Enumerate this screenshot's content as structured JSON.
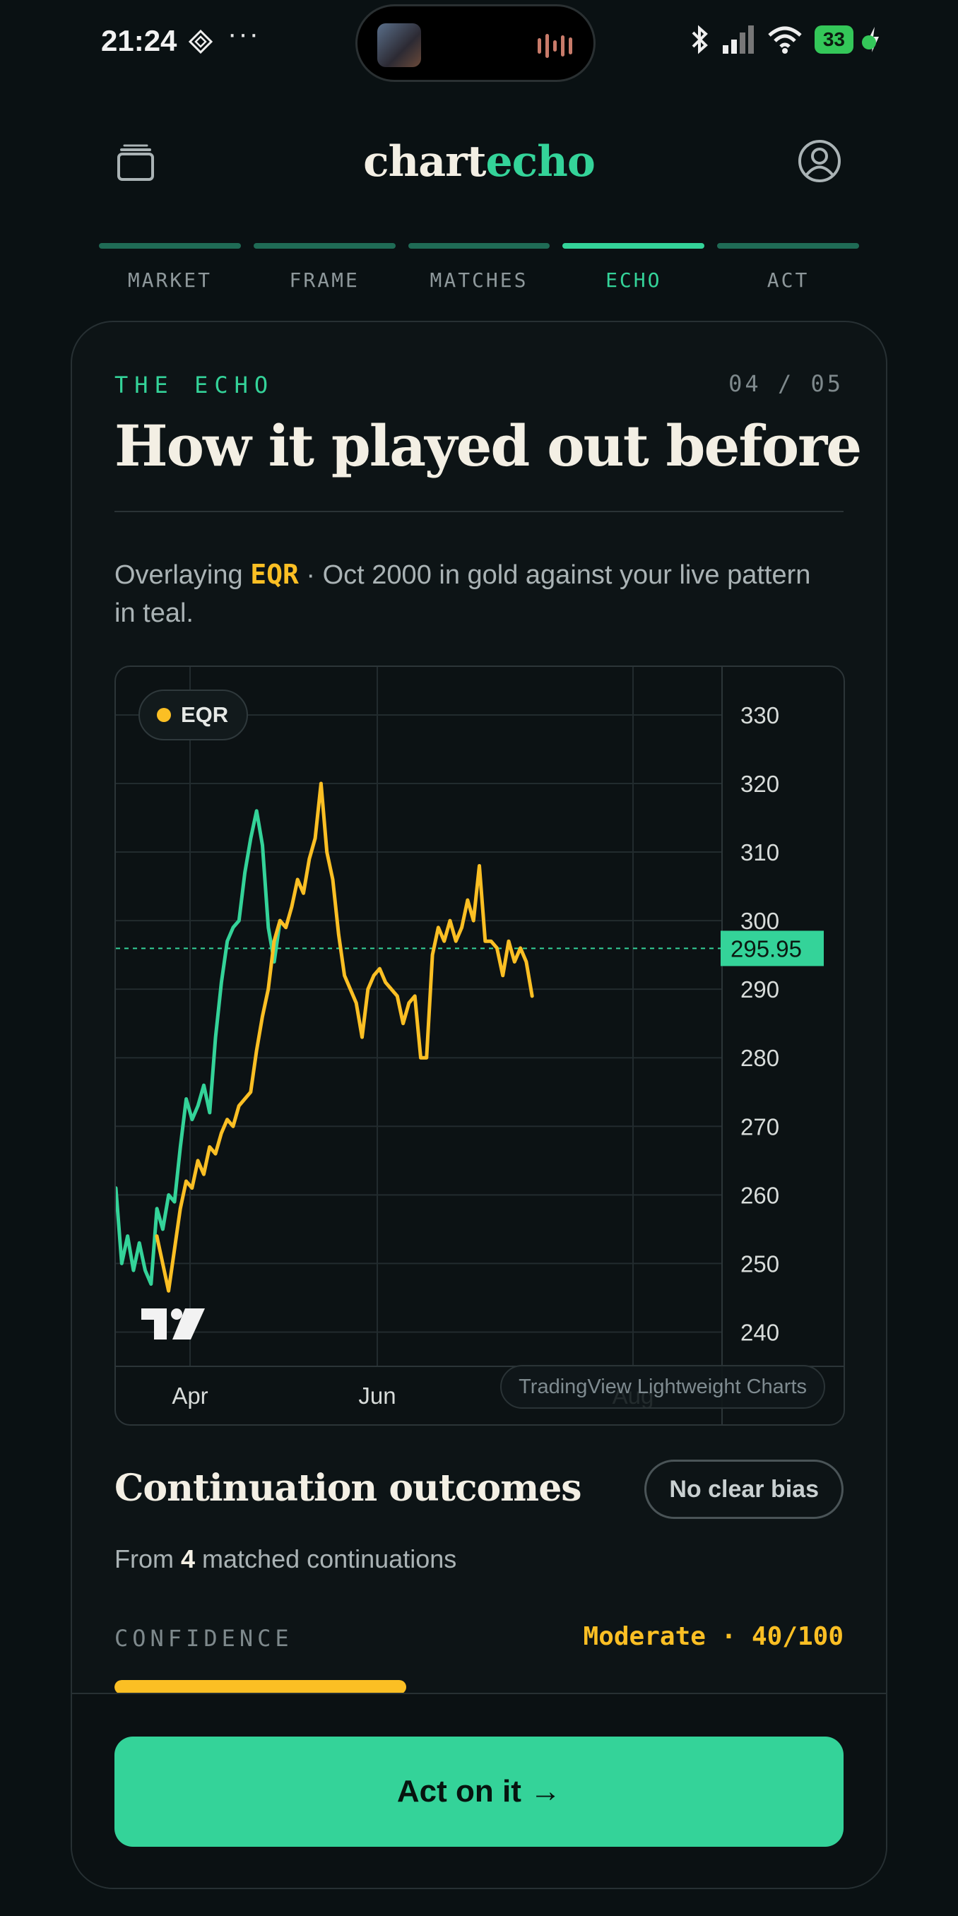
{
  "status_bar": {
    "time": "21:24",
    "dots": "···",
    "battery": "33",
    "icons": [
      "notification-diamond-icon",
      "bluetooth-icon",
      "signal-icon",
      "wifi-icon",
      "charging-icon"
    ]
  },
  "header": {
    "brand_part1": "chart",
    "brand_part2": "echo",
    "left_icon": "wallet-icon",
    "right_icon": "user-icon"
  },
  "tabs": [
    {
      "label": "MARKET",
      "active": false
    },
    {
      "label": "FRAME",
      "active": false
    },
    {
      "label": "MATCHES",
      "active": false
    },
    {
      "label": "ECHO",
      "active": true
    },
    {
      "label": "ACT",
      "active": false
    }
  ],
  "card": {
    "eyebrow": "THE ECHO",
    "step": "04 / 05",
    "title": "How it played out before",
    "desc_prefix": "Overlaying ",
    "desc_ticker": "EQR",
    "desc_suffix": " · Oct 2000 in gold against your live pattern in teal."
  },
  "chart": {
    "legend_label": "EQR",
    "badge": "TradingView Lightweight Charts",
    "colors": {
      "live": "#34d399",
      "historical": "#fbbf24",
      "grid": "#222b2e"
    }
  },
  "chart_data": {
    "type": "line",
    "x_ticks": [
      "Apr",
      "Jun",
      "Aug"
    ],
    "y_ticks": [
      330,
      320,
      310,
      300,
      290,
      280,
      270,
      260,
      250,
      240
    ],
    "ylim": [
      235,
      337
    ],
    "last_price": "295.95",
    "series": [
      {
        "name": "EQR",
        "color": "#fbbf24",
        "values": [
          254,
          250,
          246,
          252,
          258,
          262,
          261,
          265,
          263,
          267,
          266,
          269,
          271,
          270,
          273,
          274,
          275,
          281,
          286,
          290,
          297,
          300,
          299,
          302,
          306,
          304,
          309,
          312,
          320,
          310,
          306,
          298,
          292,
          290,
          288,
          283,
          290,
          292,
          293,
          291,
          290,
          289,
          285,
          288,
          289,
          280,
          280,
          295,
          299,
          297,
          300,
          297,
          299,
          303,
          300,
          308,
          297,
          297,
          296,
          292,
          297,
          294,
          296,
          294,
          289
        ]
      },
      {
        "name": "",
        "color": "#34d399",
        "values": [
          261,
          250,
          254,
          249,
          253,
          249,
          247,
          258,
          255,
          260,
          259,
          267,
          274,
          271,
          273,
          276,
          272,
          283,
          291,
          297,
          299,
          300,
          307,
          312,
          316,
          311,
          299,
          294,
          300
        ]
      }
    ]
  },
  "outcomes": {
    "title": "Continuation outcomes",
    "bias": "No clear bias",
    "from_prefix": "From ",
    "from_count": "4",
    "from_suffix": " matched continuations",
    "confidence_label": "CONFIDENCE",
    "confidence_value": "Moderate · 40/100",
    "confidence_score": 40
  },
  "action": {
    "button_label": "Act on it →"
  }
}
